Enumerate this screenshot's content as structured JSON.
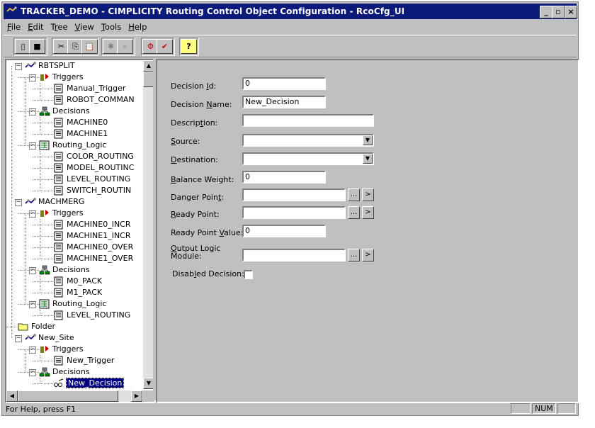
{
  "window": {
    "title": "TRACKER_DEMO - CIMPLICITY Routing Control Object Configuration - RcoCfg_UI",
    "min_glyph": "_",
    "max_glyph": "▫",
    "close_glyph": "×"
  },
  "menu": [
    "File",
    "Edit",
    "Tree",
    "View",
    "Tools",
    "Help"
  ],
  "menu_access": [
    "F",
    "E",
    "r",
    "V",
    "T",
    "H"
  ],
  "toolbar": {
    "buttons": [
      "new-icon",
      "save-icon",
      "cut-icon",
      "copy-icon",
      "paste-icon",
      "properties-icon",
      "help-context-icon",
      "configure-icon",
      "validate-icon",
      "help-icon"
    ],
    "glyphs": [
      "▯",
      "■",
      "✂",
      "⎘",
      "📋",
      "✱",
      "⌕",
      "⚙",
      "✔",
      "?"
    ]
  },
  "tree": {
    "nodes": [
      {
        "label": "RBTSPLIT",
        "level": 0,
        "icon": "site-icon",
        "expander": "−"
      },
      {
        "label": "Triggers",
        "level": 1,
        "icon": "triggers-icon",
        "expander": "−"
      },
      {
        "label": "Manual_Trigger",
        "level": 2,
        "icon": "document-icon"
      },
      {
        "label": "ROBOT_COMMAN",
        "level": 2,
        "icon": "document-icon"
      },
      {
        "label": "Decisions",
        "level": 1,
        "icon": "decisions-icon",
        "expander": "−"
      },
      {
        "label": "MACHINE0",
        "level": 2,
        "icon": "document-icon"
      },
      {
        "label": "MACHINE1",
        "level": 2,
        "icon": "document-icon"
      },
      {
        "label": "Routing_Logic",
        "level": 1,
        "icon": "routing-logic-icon",
        "expander": "−"
      },
      {
        "label": "COLOR_ROUTING",
        "level": 2,
        "icon": "document-icon"
      },
      {
        "label": "MODEL_ROUTINC",
        "level": 2,
        "icon": "document-icon"
      },
      {
        "label": "LEVEL_ROUTING",
        "level": 2,
        "icon": "document-icon"
      },
      {
        "label": "SWITCH_ROUTIN",
        "level": 2,
        "icon": "document-icon"
      },
      {
        "label": "MACHMERG",
        "level": 0,
        "icon": "site-icon",
        "expander": "−"
      },
      {
        "label": "Triggers",
        "level": 1,
        "icon": "triggers-icon",
        "expander": "−"
      },
      {
        "label": "MACHINE0_INCR",
        "level": 2,
        "icon": "document-icon"
      },
      {
        "label": "MACHINE1_INCR",
        "level": 2,
        "icon": "document-icon"
      },
      {
        "label": "MACHINE0_OVER",
        "level": 2,
        "icon": "document-icon"
      },
      {
        "label": "MACHINE1_OVER",
        "level": 2,
        "icon": "document-icon"
      },
      {
        "label": "Decisions",
        "level": 1,
        "icon": "decisions-icon",
        "expander": "−"
      },
      {
        "label": "M0_PACK",
        "level": 2,
        "icon": "document-icon"
      },
      {
        "label": "M1_PACK",
        "level": 2,
        "icon": "document-icon"
      },
      {
        "label": "Routing_Logic",
        "level": 1,
        "icon": "routing-logic-icon",
        "expander": "−"
      },
      {
        "label": "LEVEL_ROUTING",
        "level": 2,
        "icon": "document-icon"
      },
      {
        "label": "Folder",
        "level": -1,
        "icon": "folder-icon"
      },
      {
        "label": "New_Site",
        "level": 0,
        "icon": "site-icon",
        "expander": "−"
      },
      {
        "label": "Triggers",
        "level": 1,
        "icon": "triggers-icon",
        "expander": "−"
      },
      {
        "label": "New_Trigger",
        "level": 2,
        "icon": "document-icon"
      },
      {
        "label": "Decisions",
        "level": 1,
        "icon": "decisions-icon",
        "expander": "−"
      },
      {
        "label": "New_Decision",
        "level": 2,
        "icon": "decision-edit-icon",
        "selected": true
      }
    ],
    "scroll_up": "▲",
    "scroll_down": "▼",
    "scroll_left": "◀",
    "scroll_right": "▶"
  },
  "form": {
    "fields": [
      {
        "label_pre": "Decision ",
        "label_acc": "I",
        "label_post": "d:",
        "value": "0",
        "kind": "text"
      },
      {
        "label_pre": "Decision ",
        "label_acc": "N",
        "label_post": "ame:",
        "value": "New_Decision",
        "kind": "text"
      },
      {
        "label_pre": "Descrip",
        "label_acc": "t",
        "label_post": "ion:",
        "value": "",
        "kind": "text"
      },
      {
        "label_pre": "",
        "label_acc": "S",
        "label_post": "ource:",
        "value": "",
        "kind": "combo"
      },
      {
        "label_pre": "",
        "label_acc": "D",
        "label_post": "estination:",
        "value": "",
        "kind": "combo"
      },
      {
        "label_pre": "",
        "label_acc": "B",
        "label_post": "alance Weight:",
        "value": "0",
        "kind": "text"
      },
      {
        "label_pre": "Danger Poin",
        "label_acc": "t",
        "label_post": ":",
        "value": "",
        "kind": "browse"
      },
      {
        "label_pre": "",
        "label_acc": "R",
        "label_post": "eady Point:",
        "value": "",
        "kind": "browse"
      },
      {
        "label_pre": "Ready Point ",
        "label_acc": "V",
        "label_post": "alue:",
        "value": "0",
        "kind": "text"
      },
      {
        "label_pre": "",
        "label_acc": "O",
        "label_post": "utput Logic",
        "label_line2": "Module:",
        "value": "",
        "kind": "browse"
      },
      {
        "label_pre": "Disab",
        "label_acc": "l",
        "label_post": "ed Decision:",
        "value": "",
        "kind": "checkbox"
      }
    ],
    "browse_label": "...",
    "arrow_label": ">",
    "dropdown_glyph": "▼"
  },
  "status": {
    "help_text": "For Help, press F1",
    "num": "NUM"
  },
  "colors": {
    "title_bar": "#0c1a7a",
    "face": "#c0c0c0",
    "selection": "#000080"
  }
}
